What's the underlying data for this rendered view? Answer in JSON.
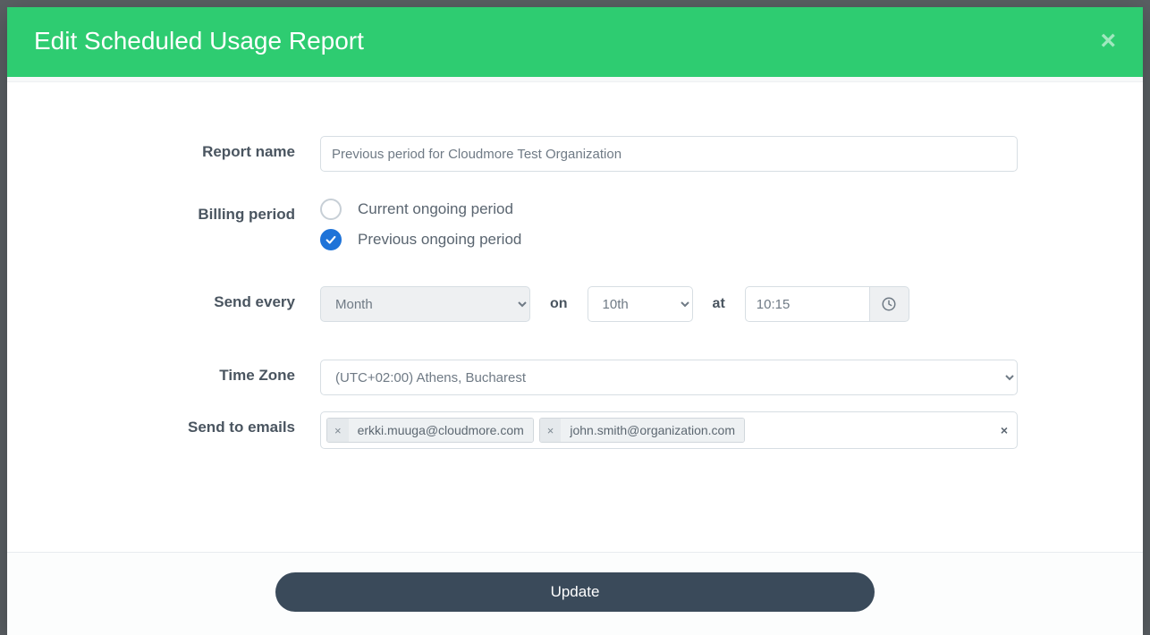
{
  "modal": {
    "title": "Edit Scheduled Usage Report"
  },
  "labels": {
    "report_name": "Report name",
    "billing_period": "Billing period",
    "send_every": "Send every",
    "on": "on",
    "at": "at",
    "time_zone": "Time Zone",
    "send_to_emails": "Send to emails"
  },
  "fields": {
    "report_name": "Previous period for Cloudmore Test Organization",
    "billing_period_options": {
      "current": "Current ongoing period",
      "previous": "Previous ongoing period"
    },
    "billing_period_selected": "previous",
    "frequency": "Month",
    "day": "10th",
    "time": "10:15",
    "timezone": "(UTC+02:00) Athens, Bucharest",
    "emails": [
      "erkki.muuga@cloudmore.com",
      "john.smith@organization.com"
    ]
  },
  "actions": {
    "update": "Update"
  }
}
